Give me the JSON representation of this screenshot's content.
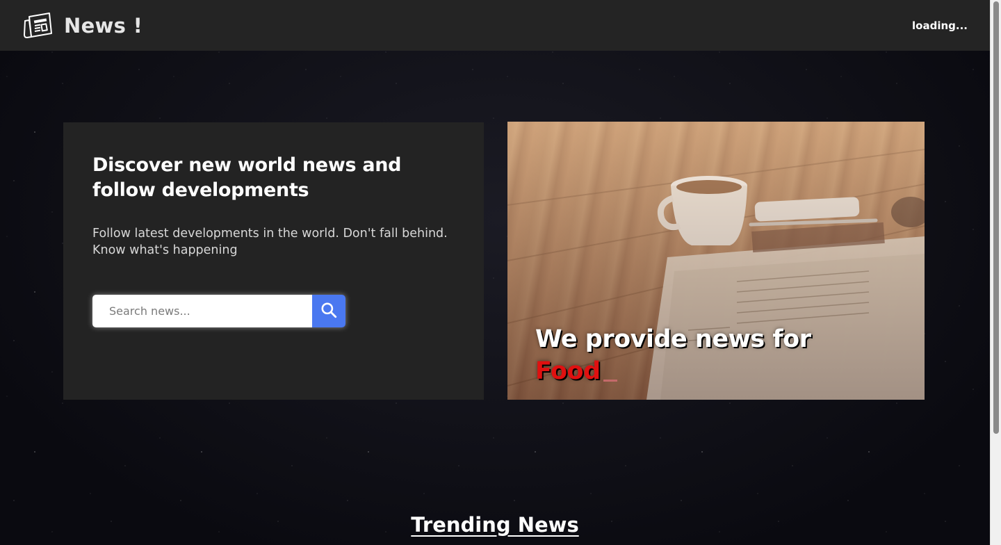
{
  "navbar": {
    "brand_icon": "newspaper-icon",
    "title": "News !",
    "status": "loading..."
  },
  "hero": {
    "title": "Discover new world news and follow developments",
    "subtitle": "Follow latest developments in the world. Don't fall behind. Know what's happening",
    "search": {
      "placeholder": "Search news...",
      "value": "",
      "button_icon": "search-icon"
    }
  },
  "banner": {
    "line1": "We provide news for",
    "line2": "Food"
  },
  "trending": {
    "title": "Trending News"
  },
  "colors": {
    "navbar_bg": "#242424",
    "card_bg": "#232323",
    "search_button": "#4a78f0",
    "highlight_red": "#e01010"
  }
}
